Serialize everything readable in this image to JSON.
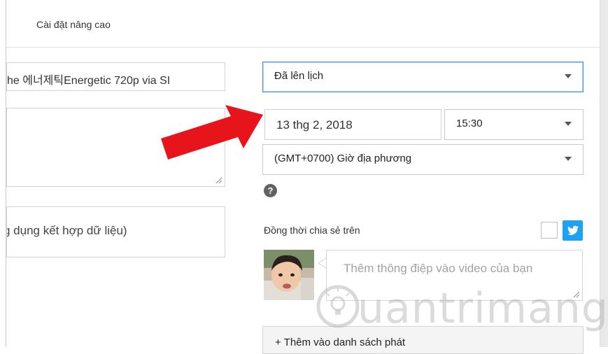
{
  "tabs": {
    "advanced_label": "Cài đặt nâng cao"
  },
  "form": {
    "title_value": "he  에너제틱Energetic 720p via SI",
    "tags_placeholder": "g dụng kết hợp dữ liệu)"
  },
  "schedule": {
    "visibility_value": "Đã lên lịch",
    "date_value": "13 thg 2, 2018",
    "time_value": "15:30",
    "timezone_value": "(GMT+0700) Giờ địa phương",
    "help_glyph": "?"
  },
  "share": {
    "label": "Đồng thời chia sẻ trên",
    "message_placeholder": "Thêm thông điệp vào video của bạn"
  },
  "playlist": {
    "add_label": "+ Thêm vào danh sách phát"
  },
  "watermark": {
    "text": "uantrimang"
  },
  "colors": {
    "accent_blue": "#4a90d9",
    "twitter": "#1da1f2",
    "arrow_red": "#e8141b"
  }
}
